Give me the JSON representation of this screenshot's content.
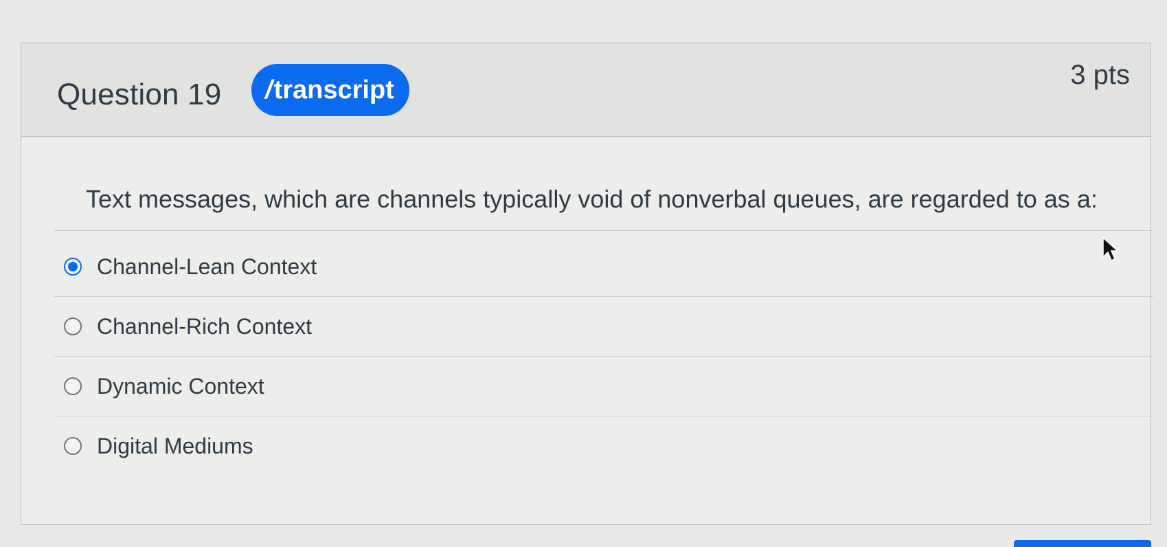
{
  "question": {
    "title": "Question 19",
    "badge_label": "transcript",
    "points": "3 pts",
    "text": "Text messages, which are channels typically void of nonverbal queues, are regarded to as a:"
  },
  "answers": [
    {
      "label": "Channel-Lean Context",
      "selected": true
    },
    {
      "label": "Channel-Rich Context",
      "selected": false
    },
    {
      "label": "Dynamic Context",
      "selected": false
    },
    {
      "label": "Digital Mediums",
      "selected": false
    }
  ],
  "colors": {
    "accent": "#0a6bf0",
    "text": "#2d3b45",
    "border": "#b8bcbe"
  },
  "icons": {
    "badge_prefix": "slash-icon",
    "cursor": "mouse-pointer-icon"
  }
}
